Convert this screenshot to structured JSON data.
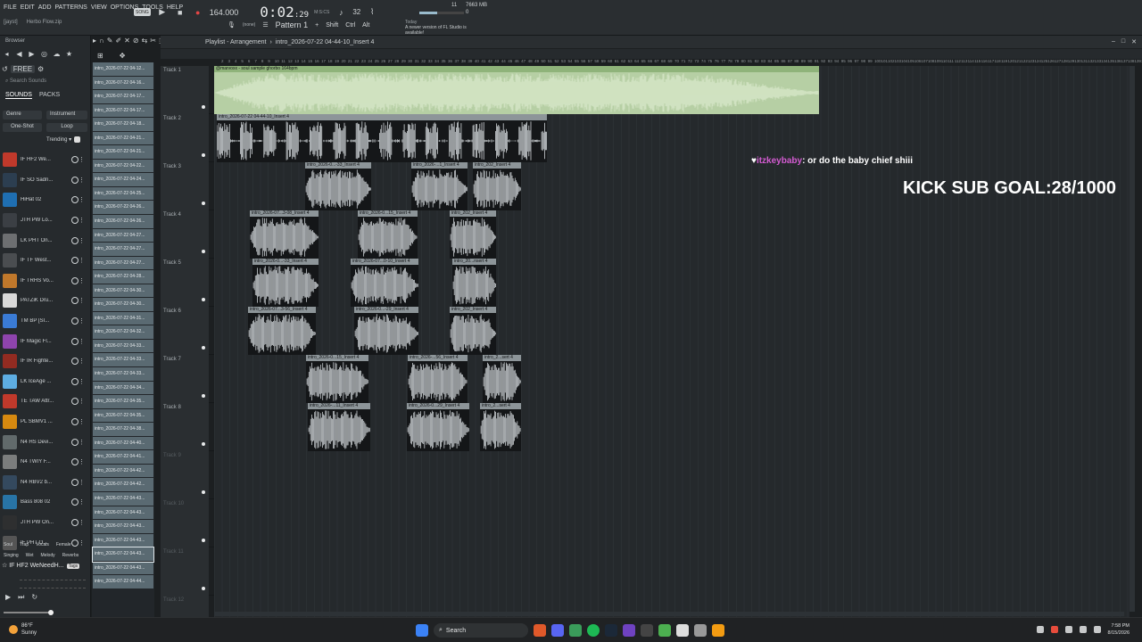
{
  "menu": [
    "FILE",
    "EDIT",
    "ADD",
    "PATTERNS",
    "VIEW",
    "OPTIONS",
    "TOOLS",
    "HELP"
  ],
  "project": {
    "user": "[jayst]",
    "file": "Herbo Flow.zip"
  },
  "transport": {
    "pat_label": "SONG",
    "bpm": "164.000",
    "time_main": "0:02",
    "time_sub": ":29",
    "time_unit": "M:S:CS",
    "mode": "32"
  },
  "cpu": {
    "voices": "11",
    "ram": "7663 MB",
    "polyphony": "0"
  },
  "pattern": {
    "none_label": "(none)",
    "name": "Pattern 1",
    "keys": [
      "Shift",
      "Ctrl",
      "Alt"
    ]
  },
  "news": {
    "when": "Today",
    "text": "A newer version of FL Studio is available!"
  },
  "browser": {
    "title": "Browser",
    "search_placeholder": "Search Sounds",
    "tabs": [
      "SOUNDS",
      "PACKS"
    ],
    "genre": "Genre",
    "instrument": "Instrument",
    "oneshot": "One-Shot",
    "loop": "Loop",
    "sort": "Trending",
    "sounds": [
      {
        "name": "IF HF2 We...",
        "color": "#c0392b"
      },
      {
        "name": "IF SO Sadn...",
        "color": "#2c3e50"
      },
      {
        "name": "HiHat 02",
        "color": "#1f6fb2"
      },
      {
        "name": "JTH PW Lo...",
        "color": "#3b3f44"
      },
      {
        "name": "LK PHT On...",
        "color": "#6d6f71"
      },
      {
        "name": "IF TF West...",
        "color": "#4a4d50"
      },
      {
        "name": "IF TRHS Vo...",
        "color": "#c0782b"
      },
      {
        "name": "PATZiK Dru...",
        "color": "#d9d9d9"
      },
      {
        "name": "TM BP [SI...",
        "color": "#3a7bd5"
      },
      {
        "name": "IF Magic Fl...",
        "color": "#8e44ad"
      },
      {
        "name": "IF IR Fighte...",
        "color": "#922b21"
      },
      {
        "name": "LK IceAge ...",
        "color": "#5dade2"
      },
      {
        "name": "TE TAW Attr...",
        "color": "#c0392b"
      },
      {
        "name": "PL SBMV1 ...",
        "color": "#d68910"
      },
      {
        "name": "N4 HS Devi...",
        "color": "#616a6b"
      },
      {
        "name": "N4 TWIY F...",
        "color": "#7b7d7d"
      },
      {
        "name": "N4 RBV2 b...",
        "color": "#34495e"
      },
      {
        "name": "Bass 808 02",
        "color": "#2874a6"
      },
      {
        "name": "JTH PW On...",
        "color": "#2e2f30"
      },
      {
        "name": "IF PHT O...",
        "color": "#555"
      }
    ],
    "tags_row1": [
      "Soul",
      "Trap",
      "Vocals",
      "Female"
    ],
    "tags_row2": [
      "Singing",
      "Wet",
      "Melody",
      "Reverbs"
    ],
    "preview_name": "IF HF2 WeNeedH...",
    "preview_tag": "Tags"
  },
  "clips": [
    "intro_2026-07-22 04-12...",
    "intro_2026-07-22 04-16...",
    "intro_2026-07-22 04-17...",
    "intro_2026-07-22 04-17...",
    "intro_2026-07-22 04-18...",
    "intro_2026-07-22 04-21...",
    "intro_2026-07-22 04-21...",
    "intro_2026-07-22 04-22...",
    "intro_2026-07-22 04-24...",
    "intro_2026-07-22 04-25...",
    "intro_2026-07-22 04-26...",
    "intro_2026-07-22 04-26...",
    "intro_2026-07-22 04-27...",
    "intro_2026-07-22 04-27...",
    "intro_2026-07-22 04-27...",
    "intro_2026-07-22 04-28...",
    "intro_2026-07-22 04-30...",
    "intro_2026-07-22 04-30...",
    "intro_2026-07-22 04-31...",
    "intro_2026-07-22 04-32...",
    "intro_2026-07-22 04-33...",
    "intro_2026-07-22 04-33...",
    "intro_2026-07-22 04-33...",
    "intro_2026-07-22 04-34...",
    "intro_2026-07-22 04-35...",
    "intro_2026-07-22 04-35...",
    "intro_2026-07-22 04-38...",
    "intro_2026-07-22 04-40...",
    "intro_2026-07-22 04-41...",
    "intro_2026-07-22 04-42...",
    "intro_2026-07-22 04-42...",
    "intro_2026-07-22 04-43...",
    "intro_2026-07-22 04-43...",
    "intro_2026-07-22 04-43...",
    "intro_2026-07-22 04-43...",
    "intro_2026-07-22 04-43...",
    "intro_2026-07-22 04-43...",
    "intro_2026-07-22 04-44..."
  ],
  "playlist": {
    "title": "Playlist - Arrangement",
    "pattern": "intro_2026-07-22 04-44-10_Insert 4",
    "ruler": [
      "2",
      "3",
      "4",
      "5",
      "6",
      "7",
      "8",
      "9",
      "10",
      "11",
      "12",
      "13",
      "14",
      "15",
      "16",
      "17",
      "18",
      "19",
      "20",
      "21",
      "22",
      "23",
      "24",
      "25",
      "26",
      "27",
      "28",
      "29",
      "30",
      "31",
      "32",
      "33",
      "34",
      "35",
      "36",
      "37",
      "38",
      "39",
      "40",
      "41",
      "42",
      "43",
      "44",
      "45",
      "46",
      "47",
      "48",
      "49",
      "50",
      "51",
      "52",
      "53",
      "54",
      "55",
      "56",
      "57",
      "58",
      "59",
      "60",
      "61",
      "62",
      "63",
      "64",
      "65",
      "66",
      "67",
      "68",
      "69",
      "70",
      "71",
      "72",
      "73",
      "74",
      "75",
      "76",
      "77",
      "78",
      "79",
      "80",
      "81",
      "82",
      "83",
      "84",
      "85",
      "86",
      "87",
      "88",
      "89",
      "90",
      "91",
      "92",
      "93",
      "94",
      "95",
      "96",
      "97",
      "98",
      "99",
      "100",
      "101",
      "102",
      "103",
      "104",
      "105",
      "106",
      "107",
      "108",
      "109",
      "110",
      "111",
      "112",
      "113",
      "114",
      "115",
      "116",
      "117",
      "118",
      "119",
      "120",
      "121",
      "122",
      "123",
      "124",
      "125",
      "126",
      "127",
      "128",
      "129",
      "130",
      "131",
      "132",
      "133",
      "134",
      "135",
      "136",
      "137",
      "138",
      "139",
      "140",
      "141"
    ],
    "tracks": [
      {
        "name": "Track 1",
        "clips": [
          {
            "label": "@marvoxx - soul sample ghorbo 164bpm",
            "color": "#b6cfa4",
            "head": "#8fb37a",
            "wave": "#d7e7c8"
          }
        ]
      },
      {
        "name": "Track 2",
        "clips": [
          {
            "label": "intro_2026-07-22 04-44-10_Insert 4",
            "color": "#151719",
            "head": "#8d9599",
            "wave": "#d0d5d8"
          }
        ]
      },
      {
        "name": "Track 3",
        "clips": [
          {
            "label": "intro_2026-0...-33_Insert 4"
          },
          {
            "label": "intro_2026-...1_Insert 4"
          },
          {
            "label": "intro_202_Insert 4"
          }
        ]
      },
      {
        "name": "Track 4",
        "clips": [
          {
            "label": "intro_2026-07...3-08_Insert 4"
          },
          {
            "label": "intro_2026-0...15_Insert 4"
          },
          {
            "label": "intro_202_Insert 4"
          }
        ]
      },
      {
        "name": "Track 5",
        "clips": [
          {
            "label": "intro_2026-0...-33_Insert 4"
          },
          {
            "label": "intro_2026-07...0-10_Insert 4"
          },
          {
            "label": "intro_20...nsert 4"
          }
        ]
      },
      {
        "name": "Track 6",
        "clips": [
          {
            "label": "intro_2026-07...3-56_Insert 4"
          },
          {
            "label": "intro_2026-0...-29_Insert 4"
          },
          {
            "label": "intro_202_Insert 4"
          }
        ]
      },
      {
        "name": "Track 7",
        "clips": [
          {
            "label": "intro_2026-0...15_Insert 4"
          },
          {
            "label": "intro_2026-...56_Insert 4"
          },
          {
            "label": "intro_2...sert 4"
          }
        ]
      },
      {
        "name": "Track 8",
        "clips": [
          {
            "label": "intro_2026-...11_Insert 4"
          },
          {
            "label": "intro_2026-0...29_Insert 4"
          },
          {
            "label": "intro_2...sert 4"
          }
        ]
      },
      {
        "name": "Track 9",
        "clips": []
      },
      {
        "name": "Track 10",
        "clips": []
      },
      {
        "name": "Track 11",
        "clips": []
      },
      {
        "name": "Track 12",
        "clips": []
      }
    ]
  },
  "overlay": {
    "chat_user": "itzkeybaby",
    "chat_text": ": or do the baby chief shiii",
    "goal": "KICK SUB GOAL:28/1000"
  },
  "taskbar": {
    "temp": "86°F",
    "weather": "Sunny",
    "search": "Search",
    "time": "7:58 PM",
    "date": "8/15/2026"
  }
}
